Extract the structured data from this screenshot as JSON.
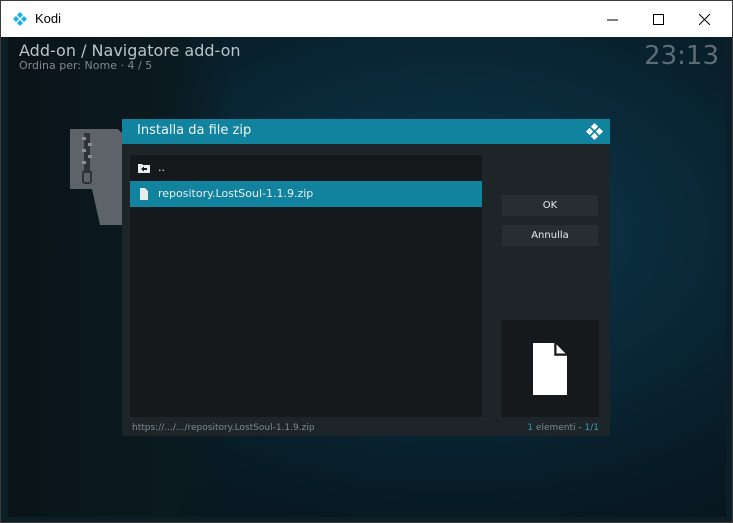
{
  "window": {
    "title": "Kodi",
    "controls": {
      "minimize": "minimize-icon",
      "maximize": "maximize-icon",
      "close": "close-icon"
    }
  },
  "header": {
    "title": "Add-on / Navigatore add-on",
    "sort_label": "Ordina per: Nome",
    "position": "4 / 5",
    "clock": "23:13"
  },
  "dialog": {
    "title": "Installa da file zip",
    "items": [
      {
        "label": "..",
        "icon": "folder-back-icon",
        "selected": false
      },
      {
        "label": "repository.LostSoul-1.1.9.zip",
        "icon": "file-icon",
        "selected": true
      }
    ],
    "ok_label": "OK",
    "cancel_label": "Annulla",
    "preview_icon": "file-preview-icon",
    "footer_path": "https://.../.../repository.LostSoul-1.1.9.zip",
    "footer_count": "1",
    "footer_count_suffix": " elementi - ",
    "footer_page": "1/1"
  },
  "colors": {
    "accent": "#12839f",
    "dialog_bg": "#1d2528",
    "list_bg": "#15191b"
  }
}
